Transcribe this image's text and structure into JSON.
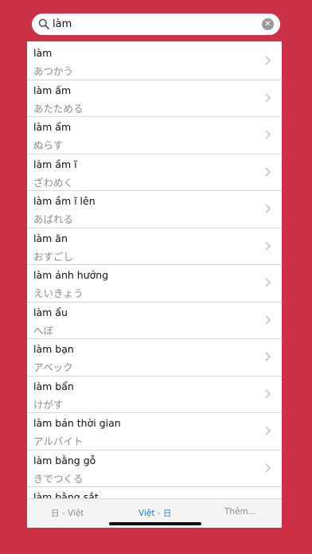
{
  "search": {
    "value": "làm",
    "clear_icon": "clear-icon",
    "search_icon": "search-icon"
  },
  "entries": [
    {
      "word": "làm",
      "reading": "あつかう"
    },
    {
      "word": "làm ấm",
      "reading": "あたためる"
    },
    {
      "word": "làm ẩm",
      "reading": "ぬらす"
    },
    {
      "word": "làm ầm ĩ",
      "reading": "ざわめく"
    },
    {
      "word": "làm ầm ĩ lên",
      "reading": "あばれる"
    },
    {
      "word": "làm ăn",
      "reading": "おすごし"
    },
    {
      "word": "làm ảnh hưởng",
      "reading": "えいきょう"
    },
    {
      "word": "làm ẩu",
      "reading": "へぼ"
    },
    {
      "word": "làm bạn",
      "reading": "アベック"
    },
    {
      "word": "làm bẩn",
      "reading": "けがす"
    },
    {
      "word": "làm bán thời gian",
      "reading": "アルバイト"
    },
    {
      "word": "làm bằng gỗ",
      "reading": "きでつくる"
    },
    {
      "word": "làm bằng sắt",
      "reading": ""
    }
  ],
  "tabs": [
    {
      "label": "日 - Việt",
      "active": false
    },
    {
      "label": "Việt - 日",
      "active": true
    },
    {
      "label": "Thêm...",
      "active": false
    }
  ],
  "colors": {
    "background": "#cc3146",
    "accent": "#2b7bd8"
  }
}
